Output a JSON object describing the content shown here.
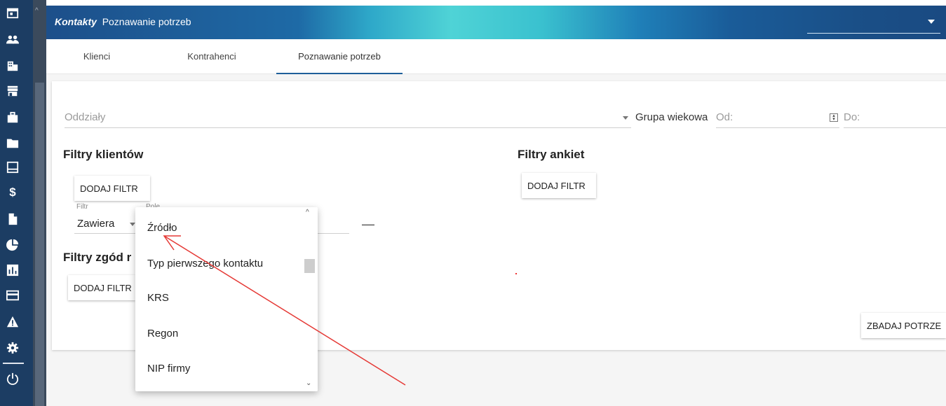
{
  "header": {
    "module": "Kontakty",
    "page": "Poznawanie potrzeb"
  },
  "tabs": [
    {
      "label": "Klienci"
    },
    {
      "label": "Kontrahenci"
    },
    {
      "label": "Poznawanie potrzeb",
      "active": true
    }
  ],
  "filters": {
    "branches_placeholder": "Oddziały",
    "age_group_label": "Grupa wiekowa",
    "from_placeholder": "Od:",
    "to_placeholder": "Do:"
  },
  "client_filters": {
    "title": "Filtry klientów",
    "add_button": "DODAJ FILTR",
    "filter_label": "Filtr",
    "field_label": "Pole",
    "filter_value": "Zawiera",
    "remove_symbol": "—"
  },
  "consent_filters": {
    "title": "Filtry zgód r",
    "add_button": "DODAJ FILTR"
  },
  "survey_filters": {
    "title": "Filtry ankiet",
    "add_button": "DODAJ FILTR"
  },
  "actions": {
    "examine_button": "ZBADAJ POTRZE"
  },
  "dropdown": {
    "options": [
      "Źródło",
      "Typ pierwszego kontaktu",
      "KRS",
      "Regon",
      "NIP firmy"
    ]
  },
  "colors": {
    "sidebar": "#1c3d63",
    "header_start": "#1d4f8a",
    "header_accent": "#4fd3d6",
    "tab_underline": "#1f5f9a",
    "annotation_arrow": "#e53935"
  },
  "sidebar": {
    "icons": [
      "calendar-icon",
      "people-icon",
      "building-icon",
      "store-icon",
      "briefcase-icon",
      "folder-icon",
      "inbox-icon",
      "dollar-icon",
      "document-icon",
      "pie-chart-icon",
      "bar-chart-icon",
      "credit-card-icon",
      "warning-icon",
      "gear-icon",
      "power-icon"
    ]
  }
}
